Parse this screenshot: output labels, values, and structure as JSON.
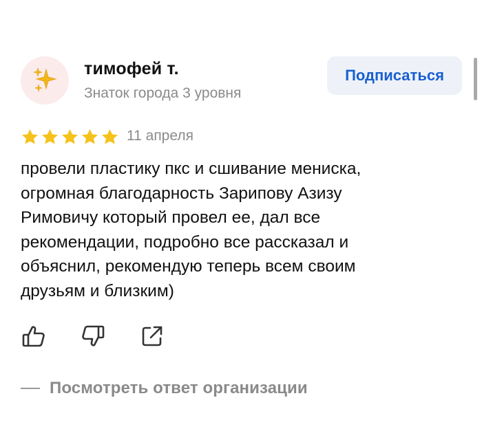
{
  "review": {
    "author": {
      "avatar_icon": "sparkles-icon",
      "name": "тимофей т.",
      "level": "Знаток города 3 уровня"
    },
    "subscribe_label": "Подписаться",
    "rating": 5,
    "date": "11 апреля",
    "text": "провели пластику пкс и сшивание мениска,\nогромная благодарность Зарипову Азизу\nРимовичу который провел ее, дал все\nрекомендации, подробно все рассказал и\nобъяснил, рекомендую теперь всем своим\nдрузьям и близким)",
    "actions": [
      "thumbs-up-icon",
      "thumbs-down-icon",
      "share-icon"
    ],
    "org_reply_label": "Посмотреть ответ организации"
  },
  "colors": {
    "star": "#f5c21b",
    "accent": "#1a5fd0",
    "muted_text": "#8a8a8a",
    "avatar_bg": "#fcebeb"
  }
}
